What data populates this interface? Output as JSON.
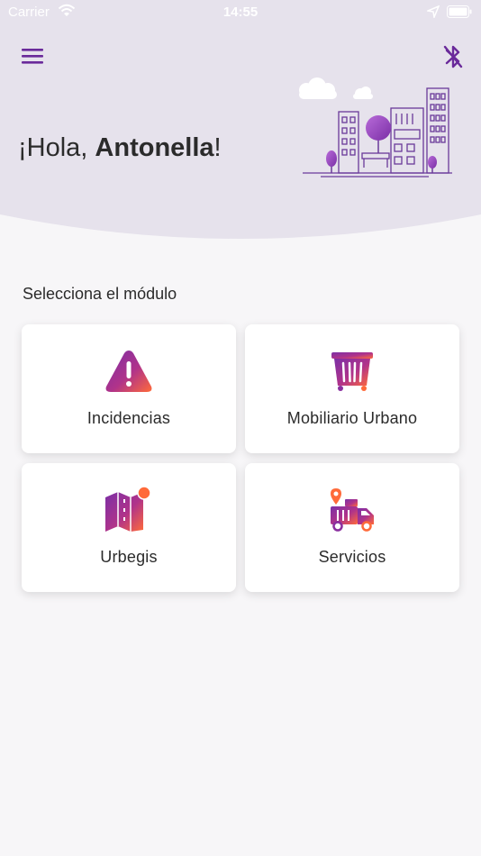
{
  "status_bar": {
    "carrier": "Carrier",
    "time": "14:55"
  },
  "header": {
    "greeting_prefix": "¡Hola, ",
    "user_name": "Antonella",
    "greeting_suffix": "!"
  },
  "section_title": "Selecciona el módulo",
  "modules": [
    {
      "label": "Incidencias",
      "icon": "warning-icon"
    },
    {
      "label": "Mobiliario Urbano",
      "icon": "trash-bin-icon"
    },
    {
      "label": "Urbegis",
      "icon": "map-icon"
    },
    {
      "label": "Servicios",
      "icon": "truck-icon"
    }
  ],
  "colors": {
    "header_bg": "#e6e2ec",
    "accent_purple": "#7b2fa6",
    "gradient_start": "#7b2fa6",
    "gradient_end": "#ff6a3a"
  }
}
